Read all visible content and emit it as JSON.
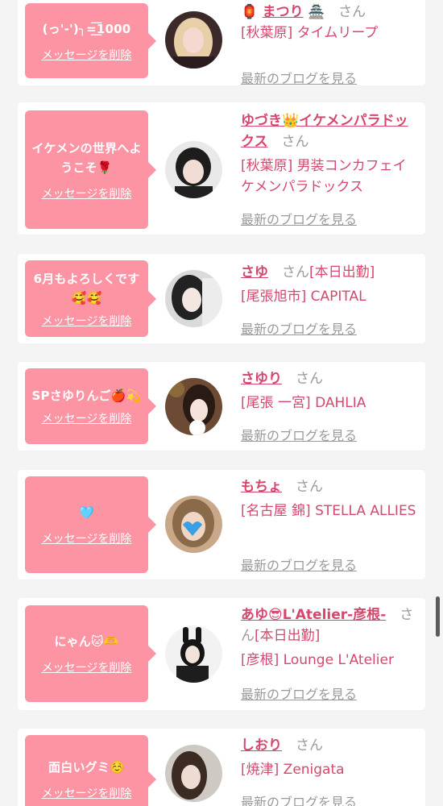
{
  "cards": [
    {
      "bubble_message": "(っ'-')╮=͟͟͞1000",
      "delete_label": "メッセージを削除",
      "name_prefix": "🏮",
      "name": "まつり",
      "name_suffix": "🏯",
      "honorific": "さん",
      "status": "",
      "shop": "[秋葉原] タイムリープ",
      "blog_label": "最新のブログを見る",
      "avatar": {
        "bg": "#3c2a2a",
        "hair": "#e8cfa8",
        "skin": "#f3d9cf"
      }
    },
    {
      "bubble_message": "イケメンの世界へようこそ🌹",
      "delete_label": "メッセージを削除",
      "name_prefix": "",
      "name": "ゆづき👑イケメンパラドックス",
      "name_suffix": "",
      "honorific": "さん",
      "status": "",
      "shop": "[秋葉原] 男装コンカフェイケメンパラドックス",
      "blog_label": "最新のブログを見る",
      "avatar": {
        "bg": "#e9e9e9",
        "hair": "#1d1d1d",
        "skin": "#f1dcd6"
      }
    },
    {
      "bubble_message": "6月もよろしくです🥰🥰",
      "delete_label": "メッセージを削除",
      "name_prefix": "",
      "name": "さゆ",
      "name_suffix": "",
      "honorific": "さん",
      "status": "[本日出勤]",
      "shop": "[尾張旭市] CAPITAL",
      "blog_label": "最新のブログを見る",
      "avatar": {
        "bg": "#dadada",
        "hair": "#222222",
        "skin": "#f4e6e1"
      }
    },
    {
      "bubble_message": "SPさゆりんご🍎💫",
      "delete_label": "メッセージを削除",
      "name_prefix": "",
      "name": "さゆり",
      "name_suffix": "",
      "honorific": "さん",
      "status": "",
      "shop": "[尾張 一宮] DAHLIA",
      "blog_label": "最新のブログを見る",
      "avatar": {
        "bg": "#6d4a34",
        "hair": "#2a1a14",
        "skin": "#f5e3dc"
      }
    },
    {
      "bubble_message": "🩵",
      "delete_label": "メッセージを削除",
      "name_prefix": "",
      "name": "もちょ",
      "name_suffix": "",
      "honorific": "さん",
      "status": "",
      "shop": "[名古屋 錦] STELLA ALLIES",
      "blog_label": "最新のブログを見る",
      "avatar": {
        "bg": "#c9a88a",
        "hair": "#8b6a4a",
        "skin": "#f0d7c5"
      }
    },
    {
      "bubble_message": "にゃん🐱🫶",
      "delete_label": "メッセージを削除",
      "name_prefix": "",
      "name": "あゆ😎L'Atelier-彦根-",
      "name_suffix": "",
      "honorific": "さん",
      "status": "[本日出勤]",
      "shop": "[彦根] Lounge L'Atelier",
      "blog_label": "最新のブログを見る",
      "avatar": {
        "bg": "#f2f2f2",
        "hair": "#151515",
        "skin": "#f3e2dc"
      }
    },
    {
      "bubble_message": "面白いグミ☺️",
      "delete_label": "メッセージを削除",
      "name_prefix": "",
      "name": "しおり",
      "name_suffix": "",
      "honorific": "さん",
      "status": "",
      "shop": "[焼津] Zenigata",
      "blog_label": "最新のブログを見る",
      "avatar": {
        "bg": "#cfc9c4",
        "hair": "#3b2b22",
        "skin": "#eedcd2"
      }
    }
  ]
}
